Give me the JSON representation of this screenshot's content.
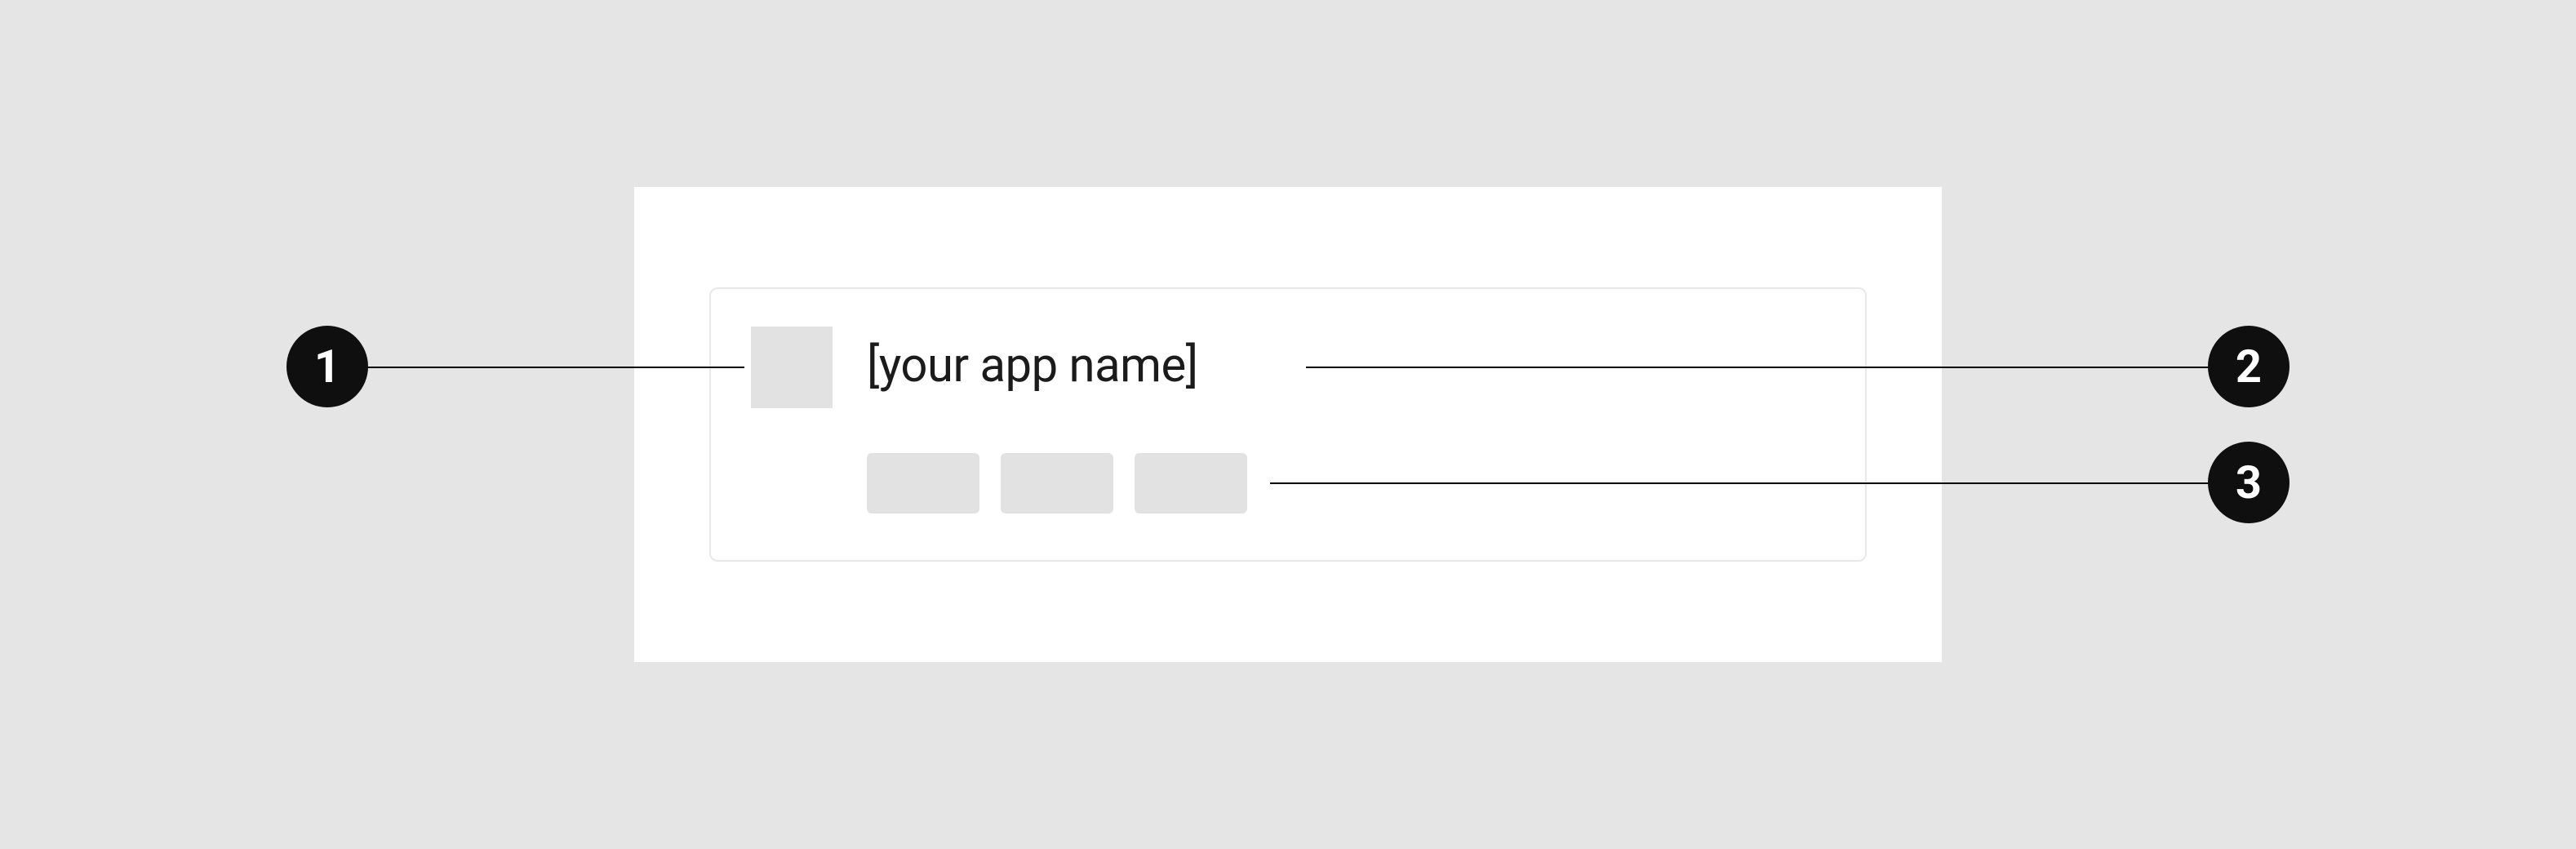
{
  "app_name_label": "[your app name]",
  "callouts": {
    "one": "1",
    "two": "2",
    "three": "3"
  }
}
